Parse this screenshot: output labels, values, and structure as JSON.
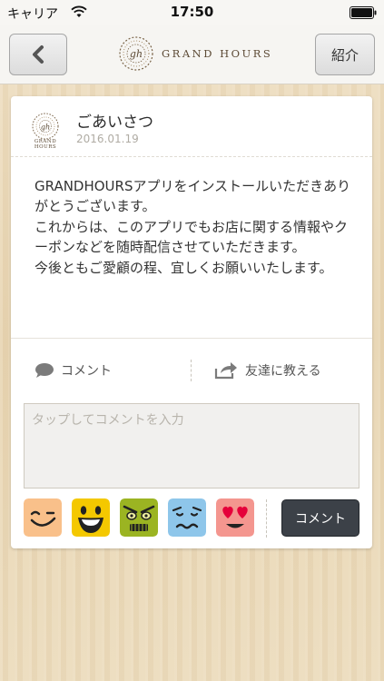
{
  "status_bar": {
    "carrier": "キャリア",
    "time": "17:50"
  },
  "header": {
    "brand_text": "GRAND HOURS",
    "intro_label": "紹介",
    "back_icon": "chevron-left-icon"
  },
  "post": {
    "title": "ごあいさつ",
    "date": "2016.01.19",
    "logo_caption": "GRAND HOURS",
    "body": "GRANDHOURSアプリをインストールいただきありがとうございます。\nこれからは、このアプリでもお店に関する情報やクーポンなどを随時配信させていただきます。\n今後ともご愛顧の程、宜しくお願いいたします。"
  },
  "actions": {
    "comment_label": "コメント",
    "share_label": "友達に教える"
  },
  "comment_box": {
    "placeholder": "タップしてコメントを入力",
    "value": ""
  },
  "stamps": [
    {
      "name": "wink-smile-stamp",
      "color": "#f9c08a"
    },
    {
      "name": "laughing-stamp",
      "color": "#f4c800"
    },
    {
      "name": "angry-green-stamp",
      "color": "#9bb422"
    },
    {
      "name": "worried-stamp",
      "color": "#8ec6ea"
    },
    {
      "name": "heart-eyes-stamp",
      "color": "#f4968f"
    }
  ],
  "submit_label": "コメント",
  "colors": {
    "submit_bg": "#3c4148",
    "card_bg": "#ffffff",
    "wood_bg": "#ead9ba"
  }
}
